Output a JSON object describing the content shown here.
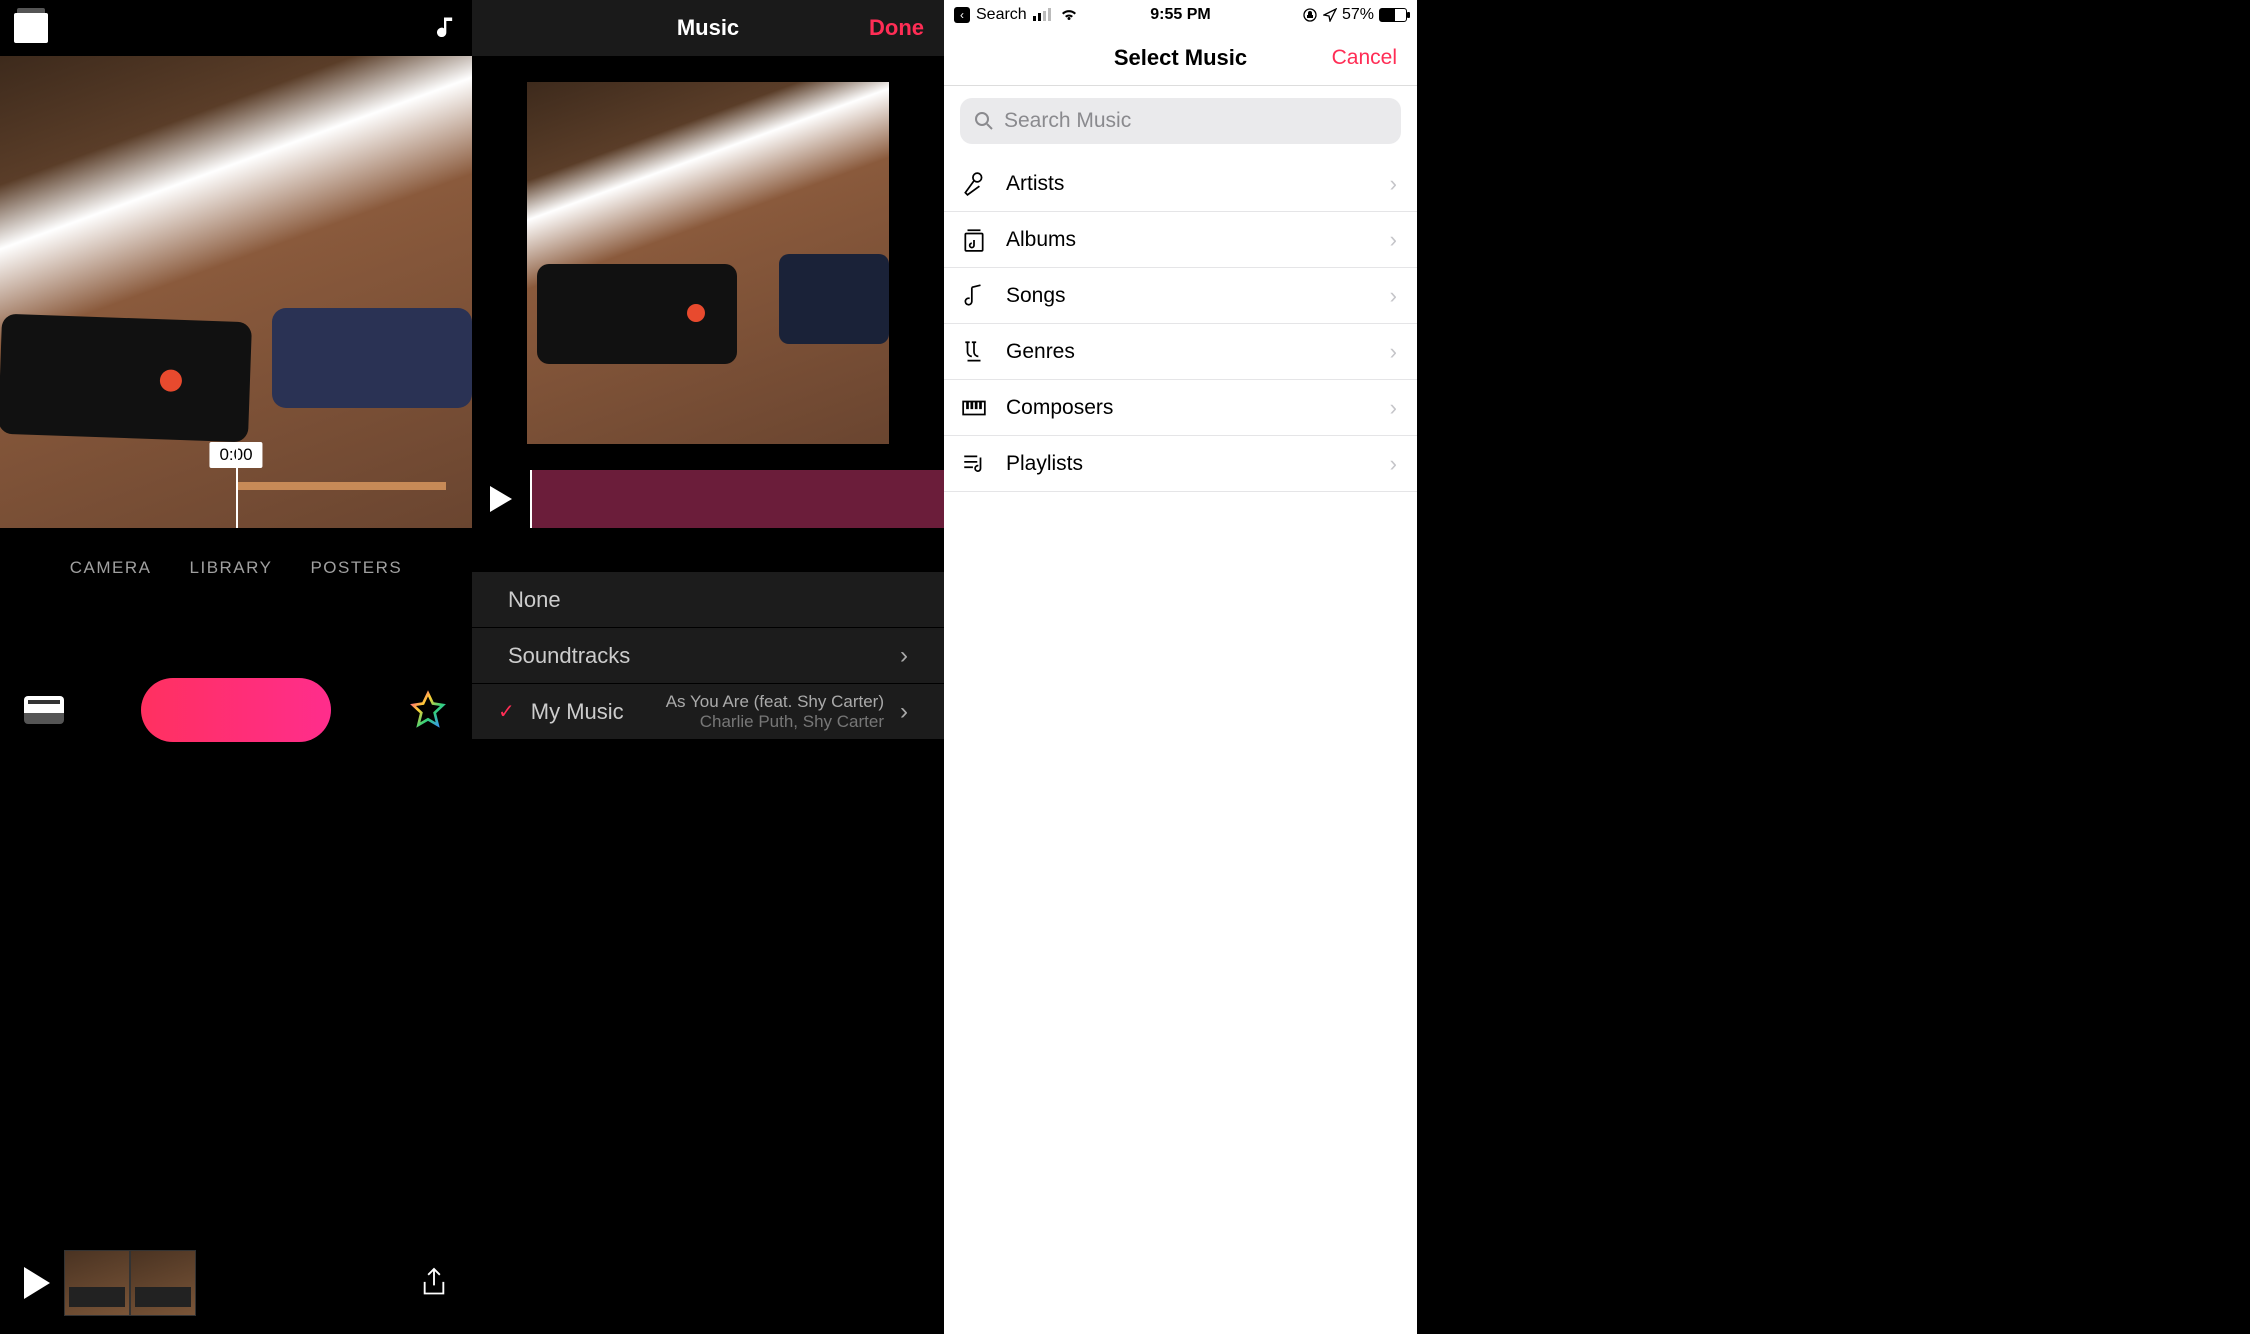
{
  "panel1": {
    "timecode": "0:00",
    "tabs": [
      "CAMERA",
      "LIBRARY",
      "POSTERS"
    ]
  },
  "panel2": {
    "title": "Music",
    "done": "Done",
    "items": {
      "none": "None",
      "soundtracks": "Soundtracks",
      "mymusic": "My Music",
      "track_title": "As You Are (feat. Shy Carter)",
      "track_artist": "Charlie Puth, Shy Carter"
    }
  },
  "panel3": {
    "status": {
      "back": "Search",
      "time": "9:55 PM",
      "battery": "57%"
    },
    "title": "Select Music",
    "cancel": "Cancel",
    "search_placeholder": "Search Music",
    "categories": [
      "Artists",
      "Albums",
      "Songs",
      "Genres",
      "Composers",
      "Playlists"
    ]
  }
}
